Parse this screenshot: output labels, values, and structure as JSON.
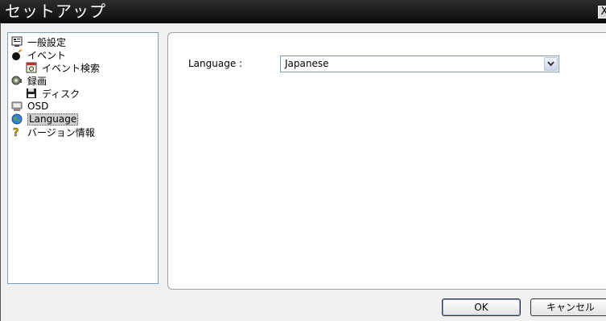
{
  "window": {
    "title": "セットアップ",
    "close_label": "X"
  },
  "tree": {
    "items": [
      {
        "label": "一般設定",
        "icon": "monitor-settings-icon"
      },
      {
        "label": "イベント",
        "icon": "bomb-icon"
      },
      {
        "label": "イベント検索",
        "icon": "event-search-icon"
      },
      {
        "label": "録画",
        "icon": "video-camera-icon"
      },
      {
        "label": "ディスク",
        "icon": "floppy-disk-icon"
      },
      {
        "label": "OSD",
        "icon": "osd-display-icon"
      },
      {
        "label": "Language",
        "icon": "globe-icon",
        "selected": true
      },
      {
        "label": "バージョン情報",
        "icon": "question-mark-icon"
      }
    ]
  },
  "language": {
    "label": "Language :",
    "selected": "Japanese"
  },
  "buttons": {
    "ok": "OK",
    "cancel": "キャンセル"
  }
}
